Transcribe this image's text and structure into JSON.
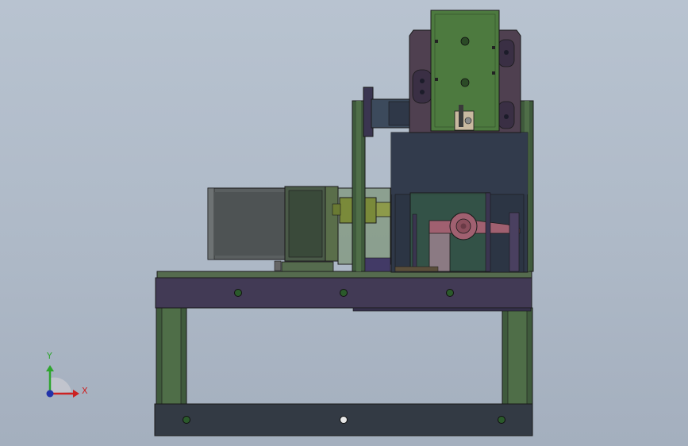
{
  "viewport": {
    "background_top": "#b8c3d0",
    "background_bottom": "#a4afbe"
  },
  "colors": {
    "frame_purple": "#423a55",
    "frame_purple_light": "#4f4866",
    "frame_green": "#3f5a3c",
    "frame_green_light": "#5c7c55",
    "motor_gray": "#5a5f60",
    "motor_body": "#3a4a3a",
    "housing_dark": "#2f3848",
    "plate_green": "#4d7a3f",
    "coupling_olive": "#7a8a3a",
    "cam_pink": "#a06070",
    "outline": "#1a1a1a"
  },
  "triad": {
    "y_label": "Y",
    "x_label": "X",
    "y_color": "#2ea52e",
    "x_color": "#cc2222",
    "z_color": "#2233aa"
  },
  "icons": [
    "axis-triad-icon"
  ]
}
